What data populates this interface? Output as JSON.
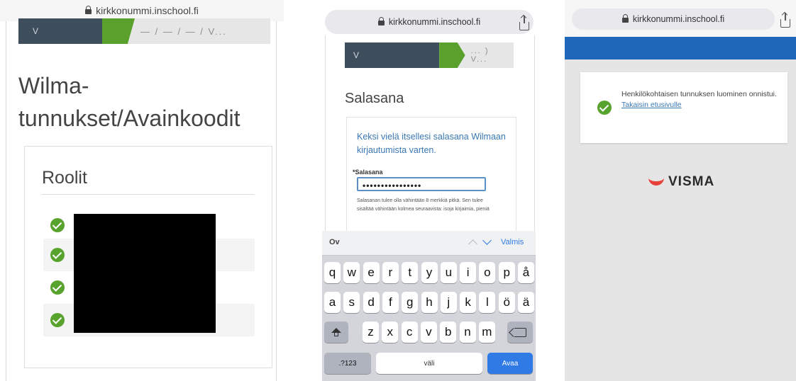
{
  "panel1": {
    "url": "kirkkonummi.inschool.fi",
    "steps": {
      "first": "V",
      "dots": "— / — / — / V..."
    },
    "title": "Wilma-tunnukset/Avainkoodit",
    "card_title": "Roolit"
  },
  "panel2": {
    "url": "kirkkonummi.inschool.fi",
    "steps": {
      "first": "V",
      "dots": "... ) V..."
    },
    "title": "Salasana",
    "intro": "Keksi vielä itsellesi salasana Wilmaan kirjautumista varten.",
    "password_label": "*Salasana",
    "password_value": "••••••••••••••••",
    "help": "Salasanan tulee olla vähintään 8 merkkiä pitkä. Sen tulee sisältää vähintään kolmea seuraavista: isoja kirjaimia, pieniä",
    "keyboard": {
      "toolbar_left": "Ov",
      "done": "Valmis",
      "row1": [
        "q",
        "w",
        "e",
        "r",
        "t",
        "y",
        "u",
        "i",
        "o",
        "p",
        "å"
      ],
      "row2": [
        "a",
        "s",
        "d",
        "f",
        "g",
        "h",
        "j",
        "k",
        "l",
        "ö",
        "ä"
      ],
      "row3": [
        "z",
        "x",
        "c",
        "v",
        "b",
        "n",
        "m"
      ],
      "numbers": ".?123",
      "space": "väli",
      "go": "Avaa"
    }
  },
  "panel3": {
    "url": "kirkkonummi.inschool.fi",
    "message": "Henkilökohtaisen tunnuksen luominen onnistui.",
    "link": "Takaisin etusivulle",
    "logo": "VISMA",
    "brand_color": "#1f67b8"
  }
}
